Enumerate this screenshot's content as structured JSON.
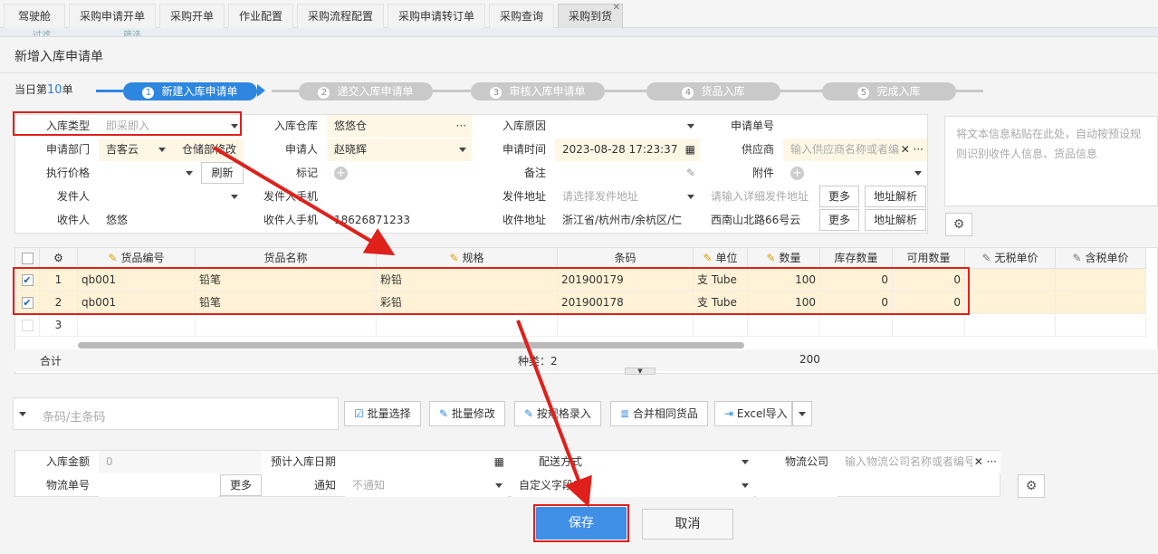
{
  "tabs": [
    "驾驶舱",
    "采购申请开单",
    "采购开单",
    "作业配置",
    "采购流程配置",
    "采购申请转订单",
    "采购查询",
    "采购到货"
  ],
  "background": {
    "tab_a": "过滤",
    "tab_b": "筛选"
  },
  "dialog": {
    "title": "新增入库申请单",
    "day_prefix": "当日第",
    "day_count": "10",
    "day_suffix": "单"
  },
  "steps": [
    {
      "num": "1",
      "label": "新建入库申请单"
    },
    {
      "num": "2",
      "label": "递交入库申请单"
    },
    {
      "num": "3",
      "label": "审核入库申请单"
    },
    {
      "num": "4",
      "label": "货品入库"
    },
    {
      "num": "5",
      "label": "完成入库"
    }
  ],
  "form": {
    "type_label": "入库类型",
    "type_value": "即采即入",
    "warehouse_label": "入库仓库",
    "warehouse_value": "悠悠仓",
    "more_dots": "···",
    "reason_label": "入库原因",
    "reqno_label": "申请单号",
    "dept_label": "申请部门",
    "dept_value": "吉客云",
    "dept_value2": "仓储部修改",
    "applicant_label": "申请人",
    "applicant_value": "赵晓辉",
    "time_label": "申请时间",
    "time_value": "2023-08-28 17:23:37",
    "supplier_label": "供应商",
    "supplier_placeholder": "输入供应商名称或者编",
    "price_label": "执行价格",
    "refresh_label": "刷新",
    "mark_label": "标记",
    "note_label": "备注",
    "attach_label": "附件",
    "sender_label": "发件人",
    "sender_phone_label": "发件人手机",
    "sender_addr_label": "发件地址",
    "sender_addr_placeholder": "请选择发件地址",
    "sender_detail_placeholder": "请输入详细发件地址",
    "more_label": "更多",
    "parse_label": "地址解析",
    "receiver_label": "收件人",
    "receiver_value": "悠悠",
    "receiver_phone_label": "收件人手机",
    "receiver_phone_value": "18626871233",
    "receiver_addr_label": "收件地址",
    "receiver_addr_value": "浙江省/杭州市/余杭区/仁",
    "receiver_detail_value": "西南山北路66号云"
  },
  "paste_box": {
    "placeholder": "将文本信息粘贴在此处，自动按预设规则识别收件人信息、货品信息"
  },
  "table": {
    "headers": [
      "货品编号",
      "货品名称",
      "规格",
      "条码",
      "单位",
      "数量",
      "库存数量",
      "可用数量",
      "无税单价",
      "含税单价"
    ],
    "rows": [
      {
        "idx": "1",
        "code": "qb001",
        "name": "铅笔",
        "spec": "粉铅",
        "barcode": "201900179",
        "unit": "支 Tube",
        "qty": "100",
        "stock": "0",
        "avail": "0"
      },
      {
        "idx": "2",
        "code": "qb001",
        "name": "铅笔",
        "spec": "彩铅",
        "barcode": "201900178",
        "unit": "支 Tube",
        "qty": "100",
        "stock": "0",
        "avail": "0"
      }
    ],
    "empty_idx": "3",
    "total_label": "合计",
    "kinds_label": "种类：2",
    "total_qty": "200"
  },
  "toolbar": {
    "barcode_placeholder": "条码/主条码",
    "batch_select": "批量选择",
    "batch_edit": "批量修改",
    "spec_entry": "按规格录入",
    "merge": "合并相同货品",
    "excel": "Excel导入"
  },
  "bottom": {
    "amount_label": "入库金额",
    "amount_value": "0",
    "est_date_label": "预计入库日期",
    "delivery_label": "配送方式",
    "logistics_label": "物流公司",
    "logistics_placeholder": "输入物流公司名称或者编号",
    "tracking_label": "物流单号",
    "more_label": "更多",
    "notify_label": "通知",
    "notify_value": "不通知",
    "custom_label": "自定义字段1"
  },
  "actions": {
    "save": "保存",
    "cancel": "取消"
  },
  "colors": {
    "accent": "#2d86df",
    "highlight": "#e0201a",
    "row_bg": "#fff2d6"
  }
}
